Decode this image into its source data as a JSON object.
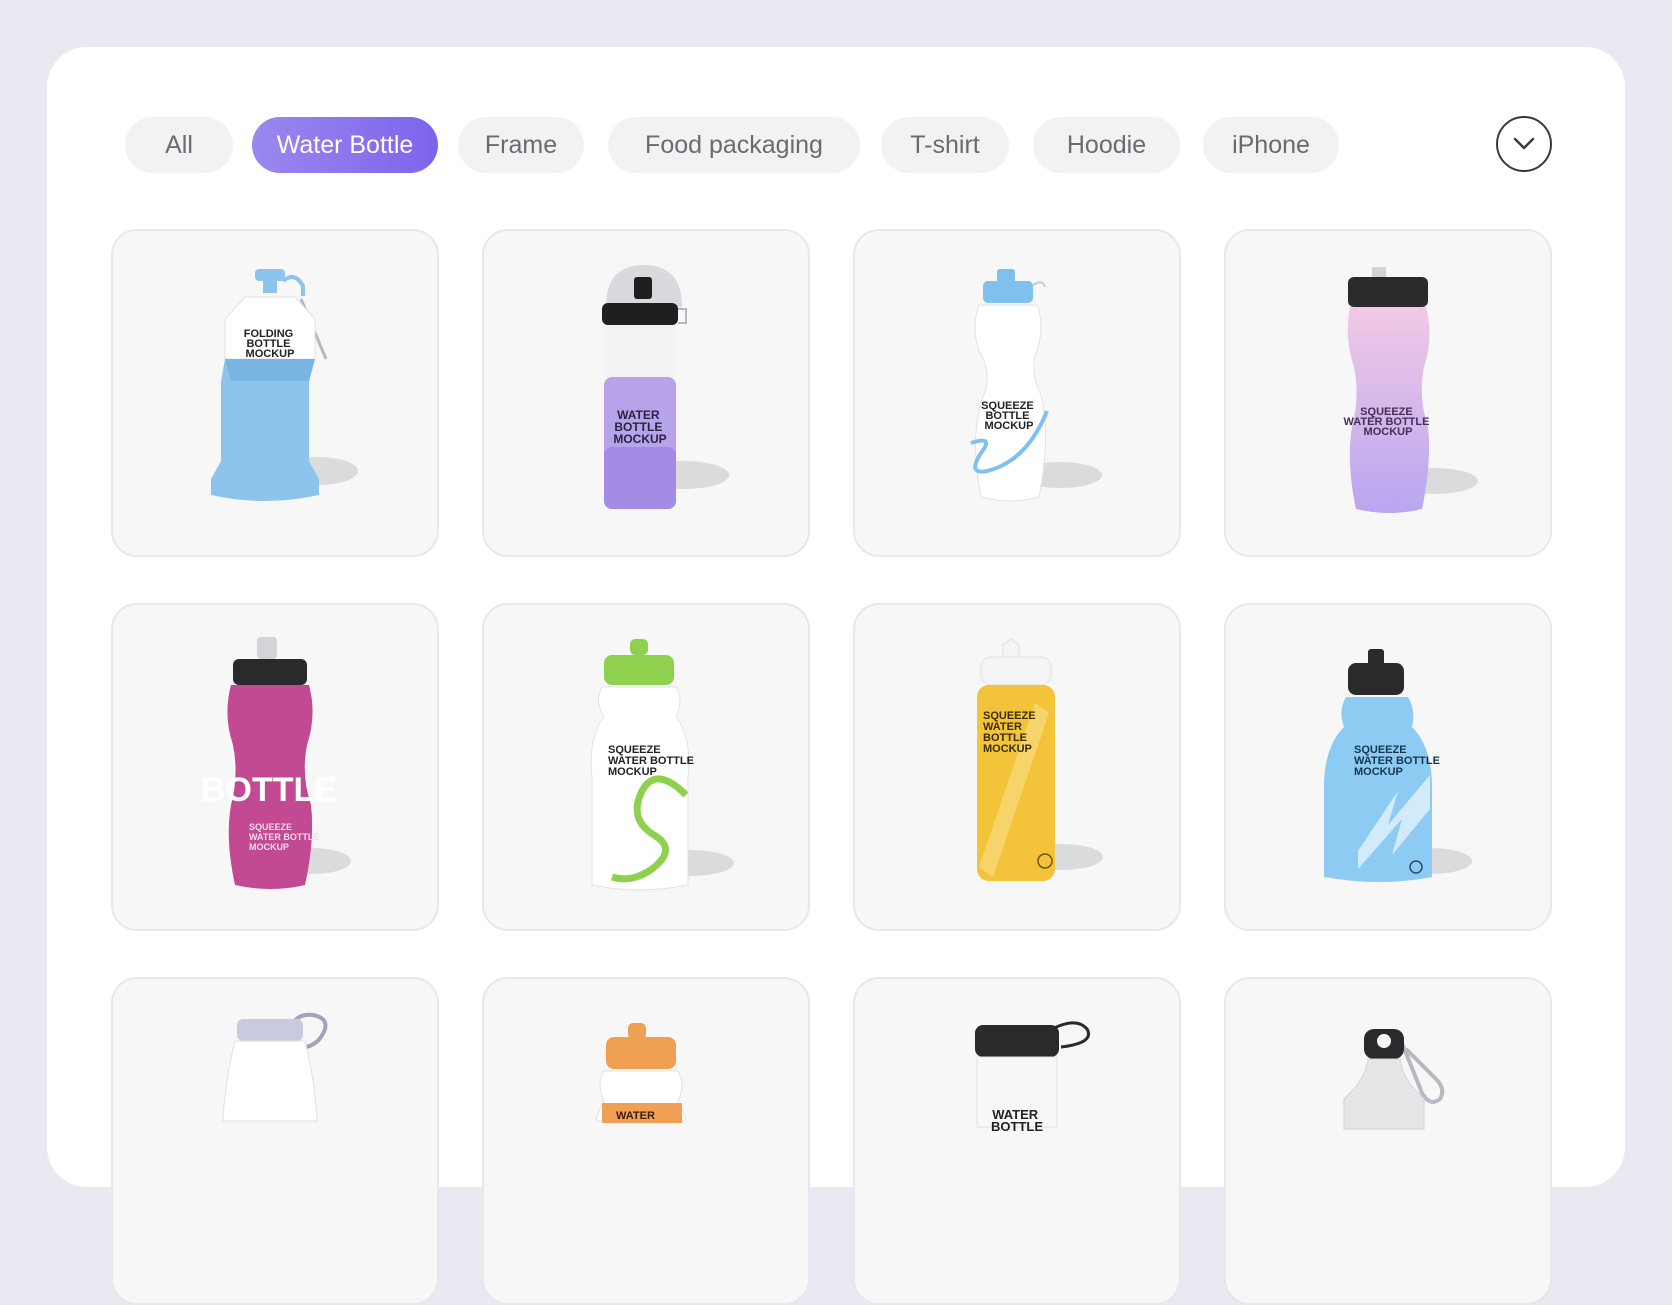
{
  "filters": {
    "tabs": [
      {
        "label": "All"
      },
      {
        "label": "Water Bottle",
        "active": true
      },
      {
        "label": "Frame"
      },
      {
        "label": "Food packaging"
      },
      {
        "label": "T-shirt"
      },
      {
        "label": "Hoodie"
      },
      {
        "label": "iPhone"
      }
    ],
    "expand_icon": "chevron-down-icon"
  },
  "grid": {
    "items": [
      {
        "name": "Folding bottle mockup",
        "label_lines": [
          "FOLDING",
          "BOTTLE",
          "MOCKUP"
        ],
        "color": "#8cc4ee",
        "cap_color": "#8cc4ee"
      },
      {
        "name": "Water bottle mockup",
        "label_lines": [
          "WATER",
          "BOTTLE",
          "MOCKUP"
        ],
        "color": "#b6a3ea",
        "cap_color": "#1f1f22"
      },
      {
        "name": "Squeeze bottle mockup",
        "label_lines": [
          "SQUEEZE",
          "BOTTLE",
          "MOCKUP"
        ],
        "color": "#ffffff",
        "cap_color": "#7fc0ee"
      },
      {
        "name": "Squeeze water bottle mockup pastel",
        "label_lines": [
          "SQUEEZE",
          "WATER BOTTLE",
          "MOCKUP"
        ],
        "color": "#e4c8ef",
        "cap_color": "#2a2a2d"
      },
      {
        "name": "Pink squeeze bottle",
        "label_lines": [
          "SQUEEZE",
          "WATER BOTTLE",
          "MOCKUP"
        ],
        "big_text": "BOTTLE",
        "color": "#c14a93",
        "cap_color": "#2a2a2d"
      },
      {
        "name": "Green cap squeeze bottle",
        "label_lines": [
          "SQUEEZE",
          "WATER BOTTLE",
          "MOCKUP"
        ],
        "color": "#ffffff",
        "cap_color": "#8fd14f"
      },
      {
        "name": "Yellow squeeze bottle",
        "label_lines": [
          "SQUEEZE",
          "WATER",
          "BOTTLE",
          "MOCKUP"
        ],
        "color": "#f3c43a",
        "cap_color": "#ffffff"
      },
      {
        "name": "Blue squeeze bottle",
        "label_lines": [
          "SQUEEZE",
          "WATER BOTTLE",
          "MOCKUP"
        ],
        "color": "#8ecbf3",
        "cap_color": "#2a2a2d"
      },
      {
        "name": "White bottle with loop",
        "label_lines": [],
        "color": "#ffffff",
        "cap_color": "#c9c9df"
      },
      {
        "name": "Orange cap squeeze bottle",
        "label_lines": [
          "WATER"
        ],
        "color": "#ffffff",
        "cap_color": "#f0a052"
      },
      {
        "name": "Clear bottle black cap",
        "label_lines": [
          "WATER",
          "BOTTLE"
        ],
        "color": "#ffffff",
        "cap_color": "#2a2a2d"
      },
      {
        "name": "Aluminum bottle carabiner",
        "label_lines": [],
        "color": "#e6e6e8",
        "cap_color": "#2a2a2d"
      }
    ]
  }
}
